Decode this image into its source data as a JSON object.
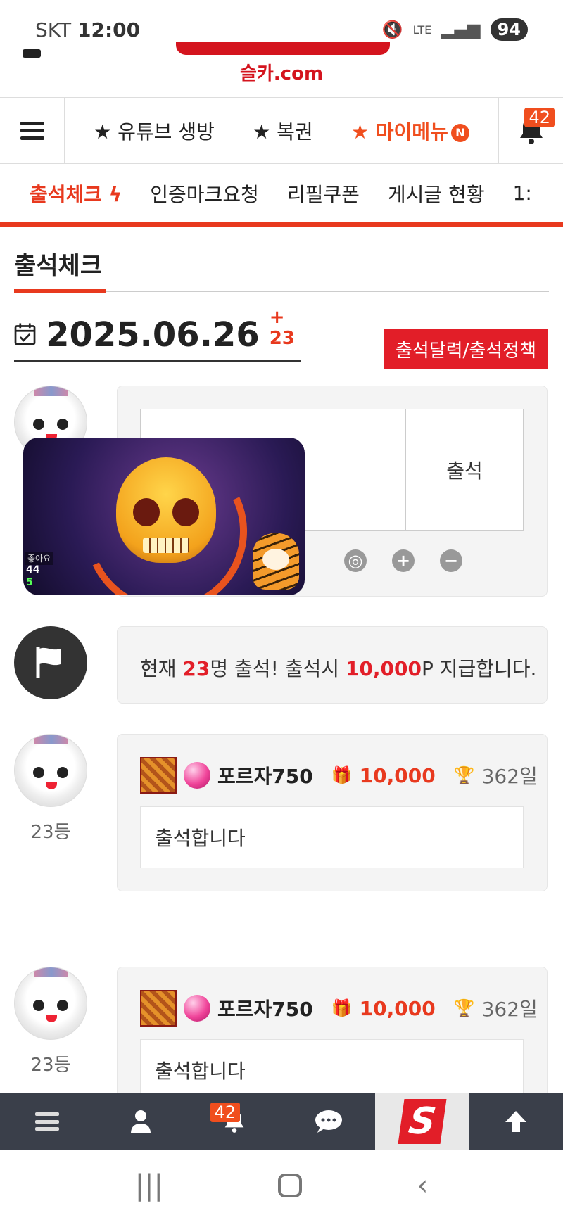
{
  "status": {
    "carrier": "SKT",
    "time": "12:00",
    "network": "LTE",
    "battery": "94"
  },
  "logo": {
    "subtitle": "슬카.com"
  },
  "top_nav": {
    "links": [
      "★ 유튜브 생방",
      "★ 복권",
      "★ 마이메뉴"
    ],
    "new_badge": "N",
    "notification_count": "42"
  },
  "sub_nav": {
    "items": [
      "출석체크",
      "인증마크요청",
      "리필쿠폰",
      "게시글 현황",
      "1:"
    ]
  },
  "page": {
    "title": "출석체크",
    "date": "2025.06.26",
    "date_count": "+ 23",
    "calendar_button": "출석달력/출석정책"
  },
  "write": {
    "attend_button": "출석"
  },
  "video": {
    "label": "좋아요",
    "num1": "44",
    "num2": "5"
  },
  "notice": {
    "prefix": "현재 ",
    "count": "23",
    "middle": "명 출석! 출석시 ",
    "points": "10,000",
    "suffix": "P 지급합니다."
  },
  "entries": [
    {
      "rank": "23등",
      "nickname": "포르자750",
      "points": "10,000",
      "days": "362일",
      "comment": "출석합니다"
    },
    {
      "rank": "23등",
      "nickname": "포르자750",
      "points": "10,000",
      "days": "362일",
      "comment": "출석합니다"
    }
  ],
  "bottom_bar": {
    "notification_count": "42",
    "logo": "S"
  },
  "colors": {
    "accent": "#e8391e",
    "red": "#e21e28",
    "dark_bar": "#3a3f4a"
  },
  "icons": [
    "hamburger-icon",
    "bell-icon",
    "lightning-icon",
    "calendar-check-icon",
    "flag-icon",
    "gift-icon",
    "trophy-icon",
    "user-icon",
    "chat-icon",
    "arrow-up-icon",
    "compass-icon",
    "plus-icon",
    "minus-icon"
  ]
}
